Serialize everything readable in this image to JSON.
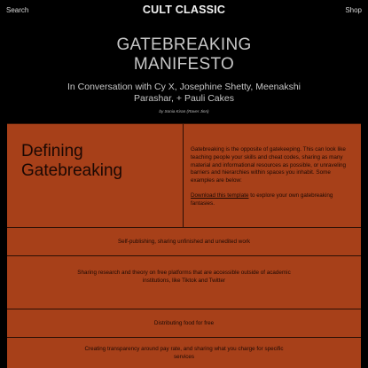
{
  "header": {
    "search_label": "Search",
    "logo_text": "CULT CLASSIC",
    "shop_label": "Shop"
  },
  "hero": {
    "title_line1": "GATEBREAKING",
    "title_line2": "MANIFESTO",
    "subtitle": "In Conversation with Cy X, Josephine Shetty, Meenakshi Parashar, + Pauli Cakes",
    "byline": "by Sonia Kiran (Raver Jinn)"
  },
  "defining": {
    "title_line1": "Defining",
    "title_line2": "Gatebreaking",
    "description": "Gatebreaking is the opposite of gatekeeping. This can look like teaching people your skills and cheat codes, sharing as many material and informational resources as possible, or unraveling barriers and hierarchies within spaces you inhabit. Some examples are below:",
    "link_text": "Download this template",
    "after_link": " to explore your own gatebreaking fantasies."
  },
  "examples": [
    "Self-publishing, sharing unfinished and unedited work",
    "Sharing research and theory on free platforms that are accessible outside of academic institutions, like Tiktok and Twitter",
    "Distributing food for free",
    "Creating transparency around pay rate, and sharing what you charge for specific services"
  ],
  "colors": {
    "background": "#000000",
    "panel": "#a74019",
    "panel_text": "#1c0904"
  }
}
